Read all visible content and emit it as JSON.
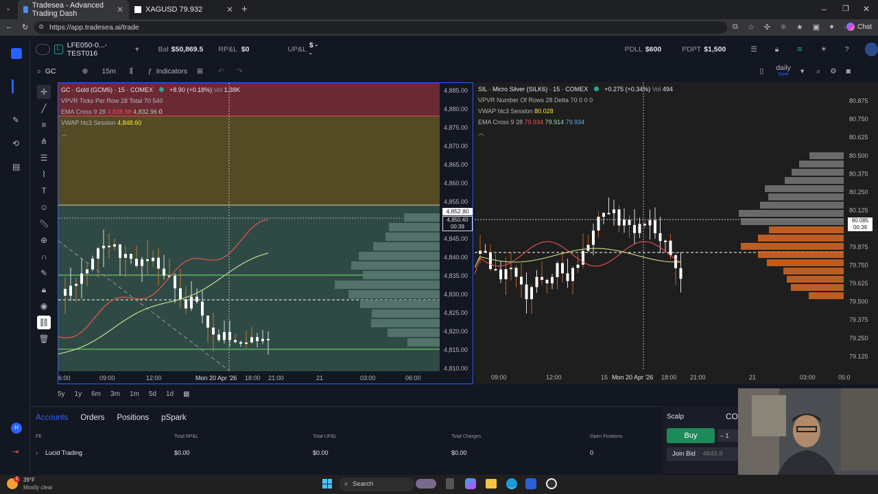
{
  "browser": {
    "tabs": [
      {
        "label": "Tradesea - Advanced Trading Dash",
        "close": "✕"
      },
      {
        "label": "XAGUSD 79.932",
        "close": "✕"
      }
    ],
    "new_tab": "+",
    "url": "https://app.tradesea.ai/trade",
    "chat_label": "Chat"
  },
  "topbar": {
    "account": "LFE050-0...-TEST016",
    "bal_label": "Bal",
    "bal_value": "$50,869.5",
    "rpl_label": "RP&L",
    "rpl_value": "$0",
    "upl_label": "UP&L",
    "upl_value": "$ --",
    "pdll_label": "PDLL",
    "pdll_value": "$600",
    "pdpt_label": "PDPT",
    "pdpt_value": "$1,500"
  },
  "toolrow": {
    "symbol": "GC",
    "interval": "15m",
    "indicators": "Indicators",
    "daily_label": "daily",
    "daily_sub": "Save"
  },
  "chart_left": {
    "title": "GC · Gold (GCM6) · 15 · COMEX",
    "change": "+8.90 (+0.18%)",
    "vol_label": "Vol",
    "vol_value": "1.38K",
    "ind1": "VPVR Ticks Per Row 28 Total 70  540",
    "ind2_name": "EMA Cross 9 28",
    "ind2_v1": "4,838.98",
    "ind2_v2": "4,832.96",
    "ind2_v3": "0",
    "ind3_name": "VWAP hlc3 Session",
    "ind3_v": "4,848.60",
    "watermark": "COMEX · GC · 15m",
    "yaxis": [
      "4,885.00",
      "4,880.00",
      "4,875.00",
      "4,870.00",
      "4,865.00",
      "4,860.00",
      "4,855.00",
      "4,850.00",
      "4,845.00",
      "4,840.00",
      "4,835.00",
      "4,830.00",
      "4,825.00",
      "4,820.00",
      "4,815.00",
      "4,810.00"
    ],
    "price_tag": "4,852.80",
    "last_tag": "4,850.40",
    "countdown": "00:39",
    "xaxis": [
      "6:00",
      "09:00",
      "12:00",
      "Mon 20 Apr '26",
      "18:00",
      "21:00",
      "21",
      "03:00",
      "06:00"
    ]
  },
  "chart_right": {
    "title": "SIL · Micro Silver (SILK6) · 15 · COMEX",
    "change": "+0.275 (+0.34%)",
    "vol_label": "Vol",
    "vol_value": "494",
    "ind1": "VPVR Number Of Rows 28 Delta 70  0  0  0",
    "ind2_name": "VWAP hlc3 Session",
    "ind2_v": "80.028",
    "ind3_name": "EMA Cross 9 28",
    "ind3_v1": "79.934",
    "ind3_v2": "79.914",
    "ind3_v3": "79.934",
    "yaxis": [
      "80.875",
      "80.750",
      "80.625",
      "80.500",
      "80.375",
      "80.250",
      "80.125",
      "80.000",
      "79.875",
      "79.750",
      "79.625",
      "79.500",
      "79.375",
      "79.250",
      "79.125"
    ],
    "price_tag": "80.085",
    "countdown": "00:39",
    "xaxis": [
      "09:00",
      "12:00",
      "15",
      "Mon 20 Apr '26",
      "18:00",
      "21:00",
      "21",
      "03:00",
      "05:0"
    ]
  },
  "timeframes": [
    "5y",
    "1y",
    "6m",
    "3m",
    "1m",
    "5d",
    "1d"
  ],
  "bottom": {
    "tabs": [
      "Accounts",
      "Orders",
      "Positions",
      "pSpark"
    ],
    "headers": [
      "FE",
      "Total RP&L",
      "Total UP&L",
      "Total Charges",
      "Open Positions"
    ],
    "row": {
      "name": "Lucid Trading",
      "rpl": "$0.00",
      "upl": "$0.00",
      "charges": "$0.00",
      "open": "0"
    }
  },
  "scalp": {
    "title": "Scalp",
    "symbol_partial": "CO",
    "buy": "Buy",
    "qty": "1",
    "join_bid": "Join Bid",
    "bid_value": "4849.8"
  },
  "taskbar": {
    "temp": "39°F",
    "weather": "Mostly clear",
    "search": "Search"
  },
  "colors": {
    "up": "#ffffff",
    "down": "#ffffff",
    "accent": "#2962ff",
    "buy": "#1e8a5a",
    "profile_orange": "#e8651a"
  }
}
